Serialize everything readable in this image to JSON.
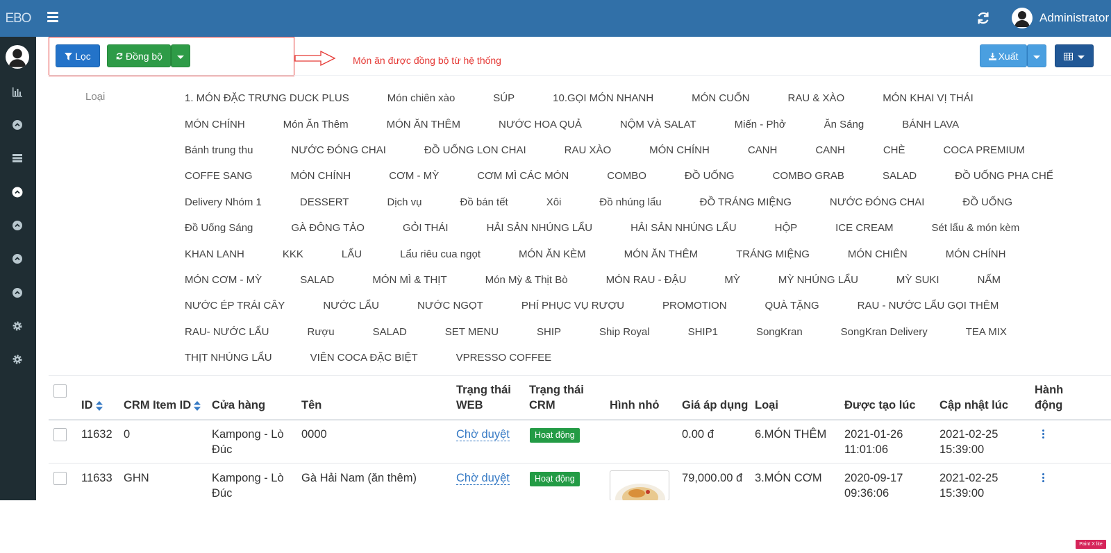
{
  "brand": "EBO",
  "user": {
    "name": "Administrator"
  },
  "toolbar": {
    "filter_label": "Lọc",
    "sync_label": "Đồng bộ",
    "export_label": "Xuất"
  },
  "annotation": "Món ăn được đồng bộ từ hệ thống",
  "colors": {
    "topbar": "#3170a8",
    "sidebar": "#1f2d33",
    "annotation": "#e53935",
    "badge": "#239b45",
    "link": "#3579c4"
  },
  "categories": {
    "label": "Loại",
    "rows": [
      [
        "1. MÓN ĐẶC TRƯNG DUCK PLUS",
        "Món chiên xào",
        "SÚP",
        "10.GỌI MÓN NHANH",
        "MÓN CUỐN",
        "RAU & XÀO",
        "MÓN KHAI VỊ THÁI"
      ],
      [
        "MÓN CHÍNH",
        "Món Ăn Thêm",
        "MÓN ĂN THÊM",
        "NƯỚC HOA QUẢ",
        "NỘM VÀ SALAT",
        "Miến - Phở",
        "Ăn Sáng",
        "BÁNH LAVA"
      ],
      [
        "Bánh trung thu",
        "NƯỚC ĐÓNG CHAI",
        "ĐỒ UỐNG LON CHAI",
        "RAU XÀO",
        "MÓN CHÍNH",
        "CANH",
        "CANH",
        "CHÈ",
        "COCA PREMIUM"
      ],
      [
        "COFFE SANG",
        "MÓN CHÍNH",
        "CƠM - MỲ",
        "CƠM MÌ CÁC MÓN",
        "COMBO",
        "ĐỒ UỐNG",
        "COMBO GRAB",
        "SALAD",
        "ĐỒ UỐNG PHA CHẾ"
      ],
      [
        "Delivery Nhóm 1",
        "DESSERT",
        "Dịch vụ",
        "Đồ bán tết",
        "Xôi",
        "Đồ nhúng lẩu",
        "ĐỒ TRÁNG MIỆNG",
        "NƯỚC ĐÓNG CHAI",
        "ĐỒ UỐNG"
      ],
      [
        "Đồ Uống Sáng",
        "GÀ ĐÔNG TẢO",
        "GỎI THÁI",
        "HẢI SẢN NHÚNG LẨU",
        "HẢI SẢN NHÚNG LẨU",
        "HỘP",
        "ICE CREAM",
        "Sét lẩu & món kèm"
      ],
      [
        "KHAN LANH",
        "KKK",
        "LẨU",
        "Lẩu riêu cua ngọt",
        "MÓN ĂN KÈM",
        "MÓN ĂN THÊM",
        "TRÁNG MIỆNG",
        "MÓN CHIÊN",
        "MÓN CHÍNH"
      ],
      [
        "MÓN CƠM - MỲ",
        "SALAD",
        "MÓN MÌ & THỊT",
        "Món Mỳ & Thịt Bò",
        "MÓN RAU - ĐẬU",
        "MỲ",
        "MỲ NHÚNG LẨU",
        "MỲ SUKI",
        "NẤM"
      ],
      [
        "NƯỚC ÉP TRÁI CÂY",
        "NƯỚC LẨU",
        "NƯỚC NGỌT",
        "PHÍ PHỤC VỤ RƯỢU",
        "PROMOTION",
        "QUÀ TẶNG",
        "RAU - NƯỚC LẨU GỌI THÊM"
      ],
      [
        "RAU- NƯỚC LẨU",
        "Rượu",
        "SALAD",
        "SET MENU",
        "SHIP",
        "Ship Royal",
        "SHIP1",
        "SongKran",
        "SongKran Delivery",
        "TEA MIX"
      ],
      [
        "THỊT NHÚNG LẨU",
        "VIÊN COCA ĐẶC BIỆT",
        "VPRESSO COFFEE"
      ]
    ]
  },
  "table": {
    "headers": {
      "id": "ID",
      "crm_item_id": "CRM Item ID",
      "store": "Cửa hàng",
      "name": "Tên",
      "web_status_1": "Trạng thái",
      "web_status_2": "WEB",
      "crm_status_1": "Trạng thái",
      "crm_status_2": "CRM",
      "thumbnail": "Hình nhỏ",
      "price": "Giá áp dụng",
      "type": "Loại",
      "created": "Được tạo lúc",
      "updated": "Cập nhật lúc",
      "action_1": "Hành",
      "action_2": "động"
    },
    "rows": [
      {
        "id": "11632",
        "crm_item_id": "0",
        "store_1": "Kampong - Lò",
        "store_2": "Đúc",
        "name": "0000",
        "web_status": "Chờ duyệt",
        "crm_status": "Hoạt động",
        "price": "0.00 đ",
        "type": "6.MÓN THÊM",
        "created_1": "2021-01-26",
        "created_2": "11:01:06",
        "updated_1": "2021-02-25",
        "updated_2": "15:39:00"
      },
      {
        "id": "11633",
        "crm_item_id": "GHN",
        "store_1": "Kampong - Lò",
        "store_2": "Đúc",
        "name": "Gà Hải Nam (ăn thêm)",
        "web_status": "Chờ duyệt",
        "crm_status": "Hoạt động",
        "price": "79,000.00 đ",
        "type": "3.MÓN CƠM",
        "created_1": "2020-09-17",
        "created_2": "09:36:06",
        "updated_1": "2021-02-25",
        "updated_2": "15:39:00"
      }
    ]
  },
  "watermark": "Paint X lite"
}
